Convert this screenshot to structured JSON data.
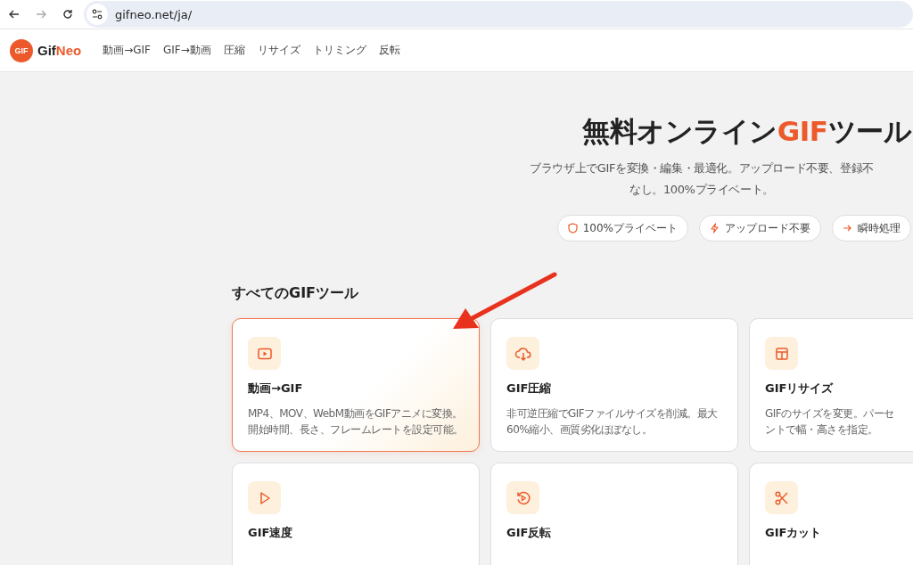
{
  "browser": {
    "url": "gifneo.net/ja/"
  },
  "nav": {
    "brand_parts": [
      "Gif",
      "Neo"
    ],
    "logo_text": "GIF",
    "links": [
      "動画→GIF",
      "GIF→動画",
      "圧縮",
      "リサイズ",
      "トリミング",
      "反転"
    ]
  },
  "hero": {
    "title": [
      "無料オンライン",
      "GIF",
      "ツール"
    ],
    "subtitle_lines": [
      "ブラウザ上でGIFを変換・編集・最適化。アップロード不要、登録不",
      "なし。100%プライベート。"
    ],
    "badges": [
      {
        "kind": "shield",
        "label": "100%プライベート"
      },
      {
        "kind": "bolt",
        "label": "アップロード不要"
      },
      {
        "kind": "arrow",
        "label": "瞬時処理"
      }
    ]
  },
  "section_title": "すべてのGIFツール",
  "cards": [
    {
      "kind": "video",
      "title": "動画→GIF",
      "description": "MP4、MOV、WebM動画をGIFアニメに変換。開始時間、長さ、フレームレートを設定可能。",
      "selected": true
    },
    {
      "kind": "cloud",
      "title": "GIF圧縮",
      "description": "非可逆圧縮でGIFファイルサイズを削減。最大60%縮小、画質劣化ほぼなし。",
      "selected": false
    },
    {
      "kind": "resize",
      "title": "GIFリサイズ",
      "description": "GIFのサイズを変更。パーセントで幅・高さを指定。",
      "selected": false
    },
    {
      "kind": "play",
      "title": "GIF速度",
      "selected": false
    },
    {
      "kind": "reverse",
      "title": "GIF反転",
      "selected": false
    },
    {
      "kind": "scissors",
      "title": "GIFカット",
      "selected": false
    }
  ],
  "annotation": {
    "kind": "arrow"
  }
}
